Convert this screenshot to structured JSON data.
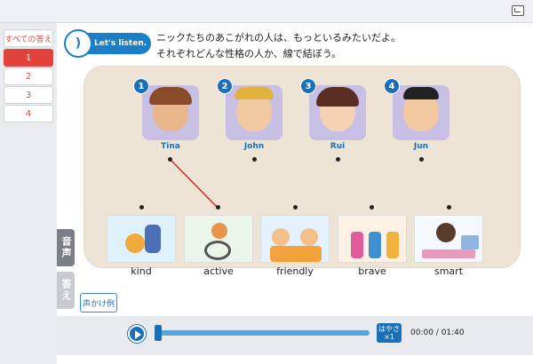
{
  "sidebar": {
    "all_answers": "すべての答え",
    "items": [
      "1",
      "2",
      "3",
      "4"
    ],
    "active_index": 0
  },
  "tabs": {
    "audio": "音声",
    "answer": "答え"
  },
  "activity": {
    "badge": "Let's listen.",
    "line1": "ニックたちのあこがれの人は、もっといるみたいだよ。",
    "line2": "それぞれどんな性格の人か、線で結ぼう。"
  },
  "people": [
    {
      "num": "1",
      "name": "Tina"
    },
    {
      "num": "2",
      "name": "John"
    },
    {
      "num": "3",
      "name": "Rui"
    },
    {
      "num": "4",
      "name": "Jun"
    }
  ],
  "words": [
    "kind",
    "active",
    "friendly",
    "brave",
    "smart"
  ],
  "example_button": "声かけ例",
  "player": {
    "speed_label": "はやさ",
    "speed_value": "×1",
    "time": "00:00 / 01:40",
    "progress": 0
  },
  "colors": {
    "accent_red": "#e3423a",
    "accent_blue": "#1a6fb8",
    "board": "#ede4d6"
  }
}
